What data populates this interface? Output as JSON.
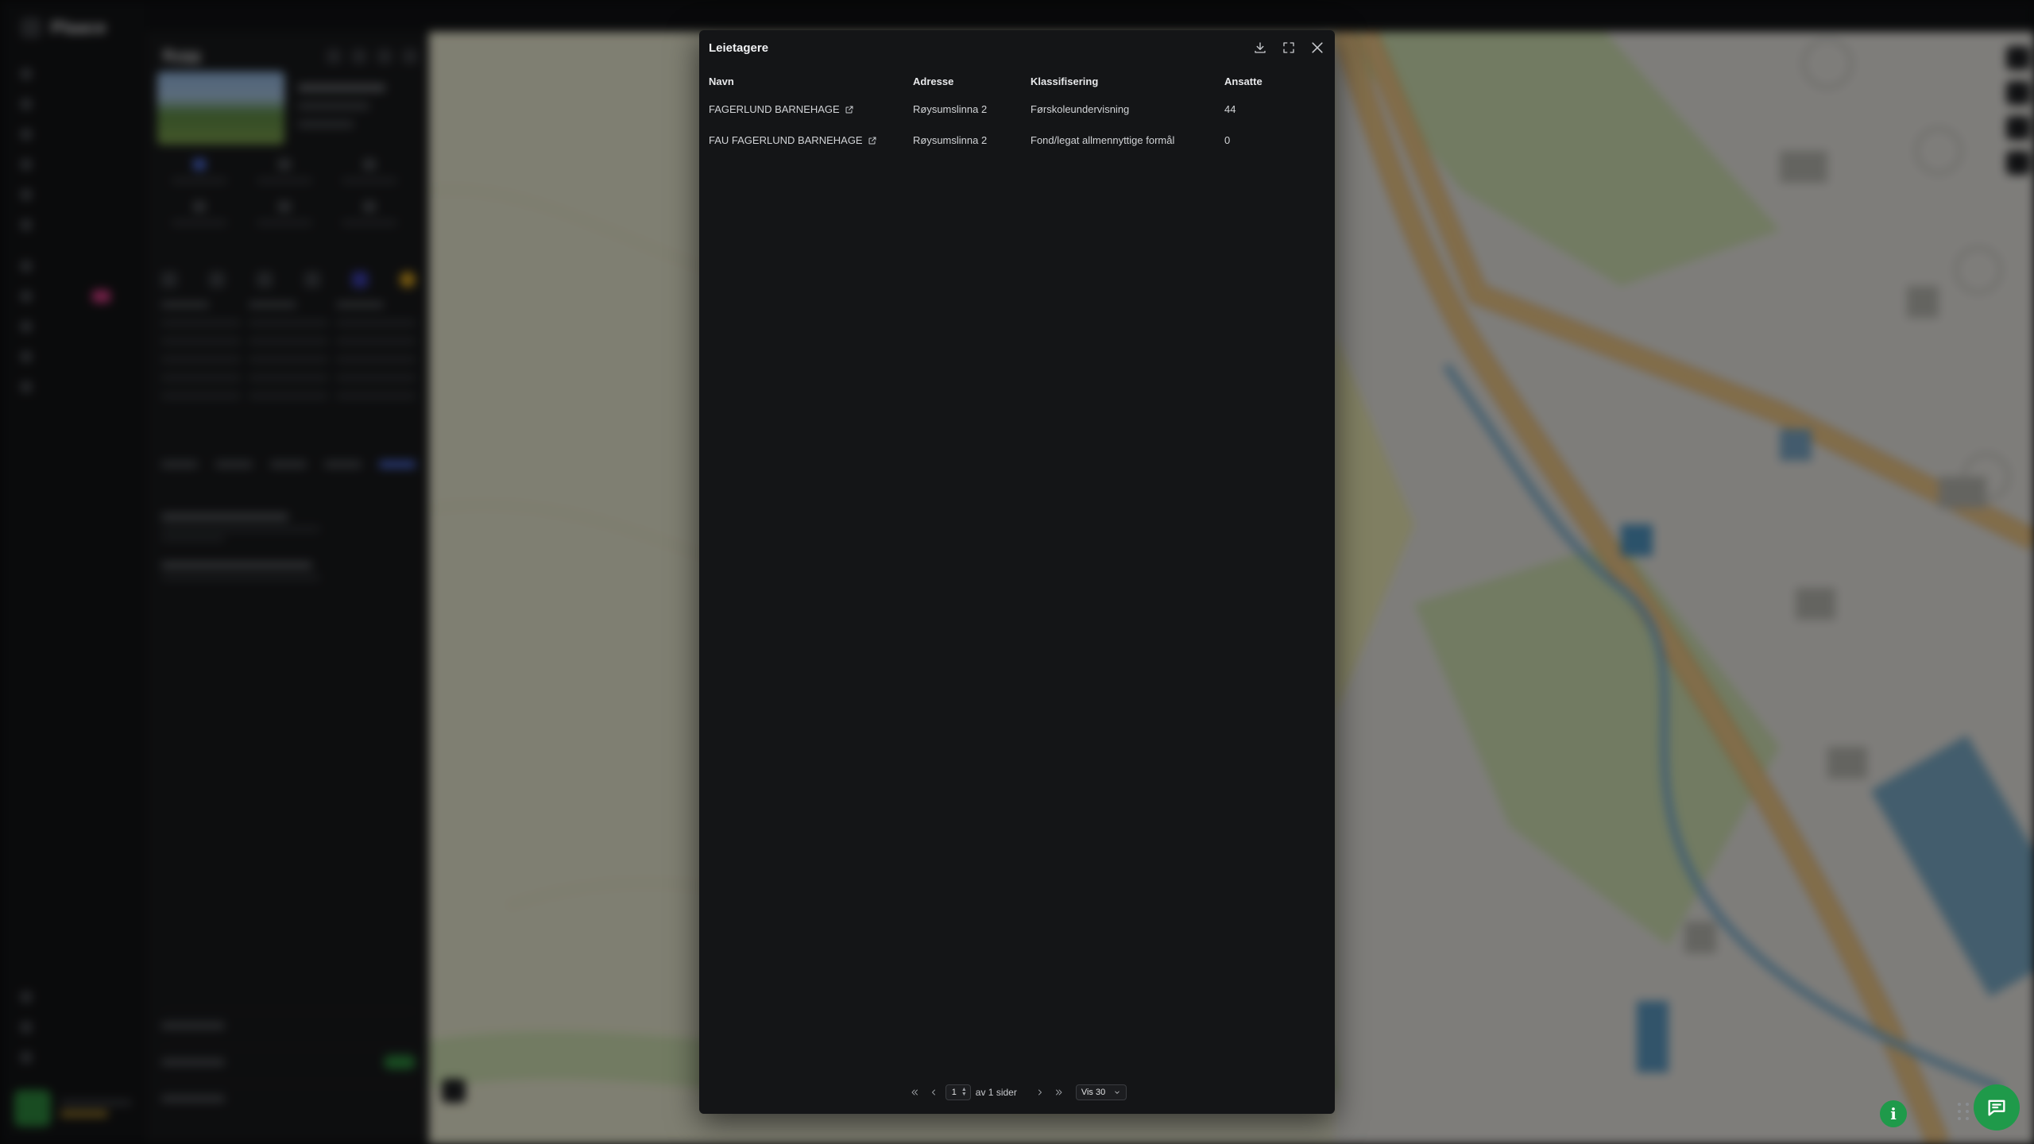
{
  "modal": {
    "title": "Leietagere",
    "columns": [
      "Navn",
      "Adresse",
      "Klassifisering",
      "Ansatte"
    ],
    "rows": [
      {
        "name": "FAGERLUND BARNEHAGE",
        "address": "Røysumslinna 2",
        "classification": "Førskoleundervisning",
        "employees": "44"
      },
      {
        "name": "FAU FAGERLUND BARNEHAGE",
        "address": "Røysumslinna 2",
        "classification": "Fond/legat allmennyttige formål",
        "employees": "0"
      }
    ],
    "pagination": {
      "current_page": "1",
      "of_pages_text": "av 1 sider",
      "page_size_label": "Vis 30"
    }
  },
  "background": {
    "app_name": "Plaace",
    "panel_title": "Bygg",
    "accent_color": "#4d6cdc",
    "brand_green": "#1f9a4a"
  },
  "icons": {
    "download": "download-icon",
    "fullscreen": "fullscreen-icon",
    "close": "close-icon",
    "external_link": "external-link-icon",
    "info": "info-icon",
    "chat": "chat-icon"
  }
}
